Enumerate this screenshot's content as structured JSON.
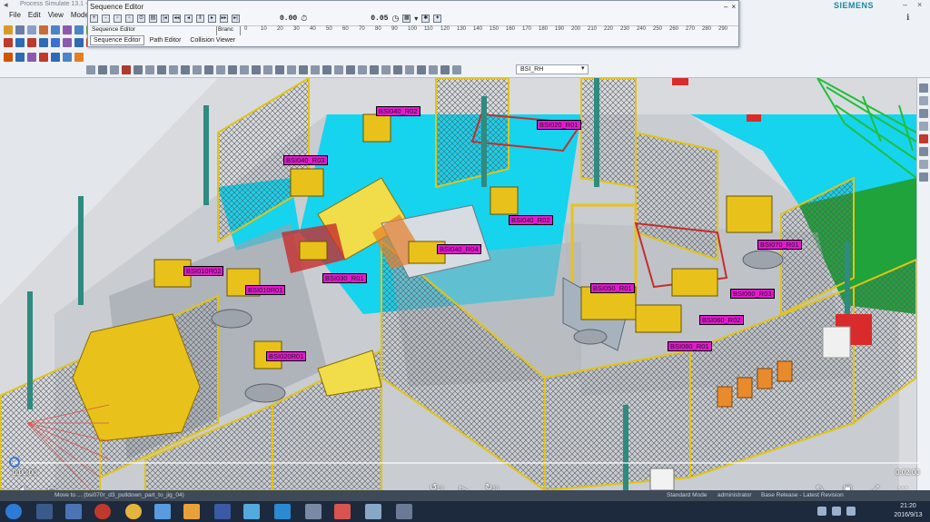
{
  "app": {
    "title": "Process Simulate 13.1 - [BSI_R...",
    "brand": "SIEMENS",
    "menu": [
      "File",
      "Edit",
      "View",
      "Modeling"
    ]
  },
  "sequence_editor": {
    "title": "Sequence Editor",
    "time_current": "0.00",
    "time_step": "0.05",
    "column_header": "Sequence Editor",
    "column_branch": "Branc",
    "ruler_ticks": [
      "0",
      "10",
      "20",
      "30",
      "40",
      "50",
      "60",
      "70",
      "80",
      "90",
      "100",
      "110",
      "120",
      "130",
      "140",
      "150",
      "160",
      "170",
      "180",
      "190",
      "200",
      "210",
      "220",
      "230",
      "240",
      "250",
      "260",
      "270",
      "280",
      "290"
    ],
    "tabs": [
      "Sequence Editor",
      "Path Editor",
      "Collision Viewer"
    ],
    "active_tab": 0
  },
  "toolbar": {
    "study_combo": "BSI_RH"
  },
  "robots": [
    {
      "label": "BSI040_R02"
    },
    {
      "label": "BSI020_R01"
    },
    {
      "label": "BSI040_R03"
    },
    {
      "label": "BSI040_R02"
    },
    {
      "label": "BSI040_R04"
    },
    {
      "label": "BSI070_R01"
    },
    {
      "label": "BSI010R02"
    },
    {
      "label": "BSI010R01"
    },
    {
      "label": "BSI030_R01"
    },
    {
      "label": "BSI050_R01"
    },
    {
      "label": "BSI060_R03"
    },
    {
      "label": "BSI060_R02"
    },
    {
      "label": "BSI060_R01"
    },
    {
      "label": "BSI020R01"
    }
  ],
  "player": {
    "current_time": "0:00:00",
    "duration": "0:02:00",
    "rewind_label": "10",
    "forward_label": "30"
  },
  "statusbar": {
    "message": "Move to ... (bsi070r_d3_pulldown_part_to_jig_04)",
    "mode": "Standard Mode",
    "user": "administrator",
    "release": "Base Release - Latest Revision"
  },
  "taskbar": {
    "time": "21:20",
    "date": "2016/9/13"
  },
  "colors": {
    "label_bg": "#e617d2",
    "fence": "#e2c414",
    "floor_cyan": "#18d6f0",
    "floor_green": "#1fa33a",
    "robot_yellow": "#e8c21a"
  }
}
